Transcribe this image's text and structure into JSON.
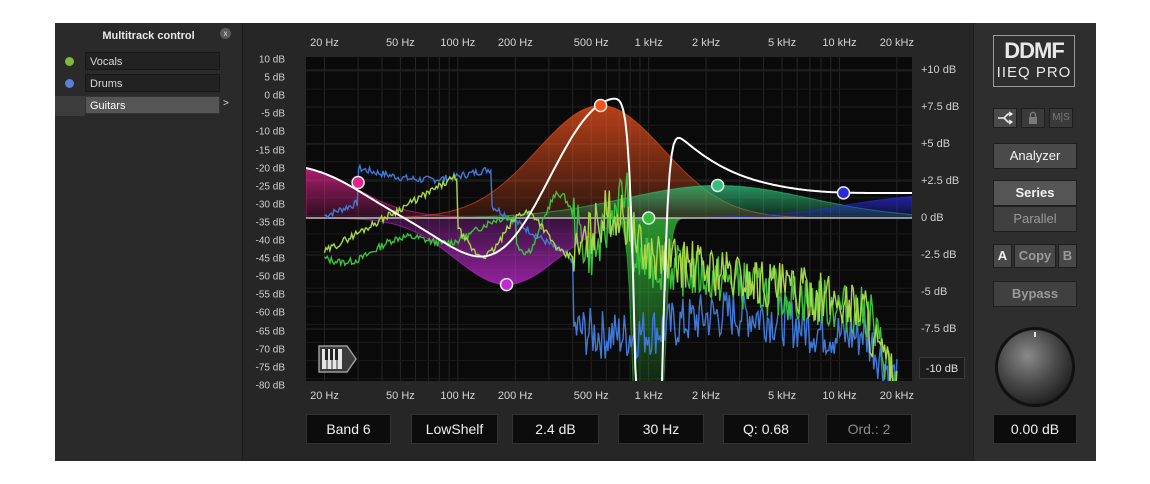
{
  "multitrack": {
    "title": "Multitrack control",
    "close": "x",
    "tracks": [
      {
        "name": "Vocals",
        "color": "#7cbc3b",
        "selected": false
      },
      {
        "name": "Drums",
        "color": "#5b7fd6",
        "selected": false
      },
      {
        "name": "Guitars",
        "color": "",
        "selected": true
      }
    ],
    "arrow": ">"
  },
  "graph": {
    "freq_labels": [
      "20 Hz",
      "50 Hz",
      "100 Hz",
      "200 Hz",
      "500 Hz",
      "1 kHz",
      "2 kHz",
      "5 kHz",
      "10 kHz",
      "20 kHz"
    ],
    "freq_values": [
      20,
      50,
      100,
      200,
      500,
      1000,
      2000,
      5000,
      10000,
      20000
    ],
    "db_left_labels": [
      "10 dB",
      "5 dB",
      "0 dB",
      "-5 dB",
      "-10 dB",
      "-15 dB",
      "-20 dB",
      "-25 dB",
      "-30 dB",
      "-35 dB",
      "-40 dB",
      "-45 dB",
      "-50 dB",
      "-55 dB",
      "-60 dB",
      "-65 dB",
      "-70 dB",
      "-75 dB",
      "-80 dB"
    ],
    "db_left_values": [
      10,
      5,
      0,
      -5,
      -10,
      -15,
      -20,
      -25,
      -30,
      -35,
      -40,
      -45,
      -50,
      -55,
      -60,
      -65,
      -70,
      -75,
      -80
    ],
    "db_right_labels": [
      "+10 dB",
      "+7.5 dB",
      "+5 dB",
      "+2.5 dB",
      "0 dB",
      "-2.5 dB",
      "-5 dB",
      "-7.5 dB"
    ],
    "db_right_values": [
      10,
      7.5,
      5,
      2.5,
      0,
      -2.5,
      -5,
      -7.5
    ],
    "range_button": "-10 dB",
    "bands": [
      {
        "freq": 30,
        "gain": 2.4,
        "color": "#e0248f"
      },
      {
        "freq": 180,
        "gain": -4.5,
        "color": "#c02ad0"
      },
      {
        "freq": 560,
        "gain": 7.6,
        "color": "#f0521e"
      },
      {
        "freq": 1000,
        "gain": 0.0,
        "color": "#34c13a"
      },
      {
        "freq": 2300,
        "gain": 2.2,
        "color": "#2fc27a"
      },
      {
        "freq": 10500,
        "gain": 1.7,
        "color": "#2a2ad8"
      }
    ],
    "colors": {
      "eq_curve": "#ffffff",
      "vocals": "#a8d84a",
      "drums": "#3f78d6",
      "guitars": "#3cc23c"
    }
  },
  "band_fields": {
    "band": "Band 6",
    "type": "LowShelf",
    "gain": "2.4 dB",
    "freq": "30 Hz",
    "q": "Q: 0.68",
    "order": "Ord.: 2"
  },
  "right_panel": {
    "logo_top": "DDMF",
    "logo_bottom": "IIEQ PRO",
    "icon_routing": "route-icon",
    "icon_lock": "lock-icon",
    "ms_label": "M|S",
    "analyzer": "Analyzer",
    "series": "Series",
    "parallel": "Parallel",
    "a": "A",
    "copy": "Copy",
    "b": "B",
    "bypass": "Bypass",
    "output_gain": "0.00 dB"
  }
}
